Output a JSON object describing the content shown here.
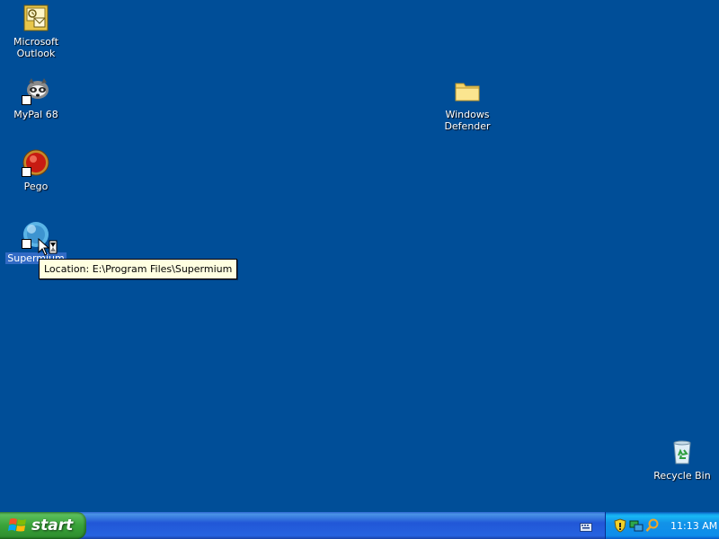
{
  "desktop": {
    "background": "#004e98",
    "icons": [
      {
        "label_line1": "Microsoft",
        "label_line2": "Outlook",
        "icon": "outlook-icon"
      },
      {
        "label_line1": "MyPal 68",
        "label_line2": "",
        "icon": "mypal-icon"
      },
      {
        "label_line1": "Pego",
        "label_line2": "",
        "icon": "pego-icon"
      },
      {
        "label_line1": "Supermium",
        "label_line2": "",
        "icon": "supermium-icon"
      },
      {
        "label_line1": "Windows",
        "label_line2": "Defender",
        "icon": "folder-icon"
      },
      {
        "label_line1": "Recycle Bin",
        "label_line2": "",
        "icon": "recycle-bin-icon"
      }
    ]
  },
  "tooltip": {
    "text": "Location: E:\\Program Files\\Supermium"
  },
  "taskbar": {
    "start_label": "start",
    "clock": "11:13 AM",
    "tray_icons": [
      "security-shield-icon",
      "network-icon",
      "search-icon"
    ]
  }
}
